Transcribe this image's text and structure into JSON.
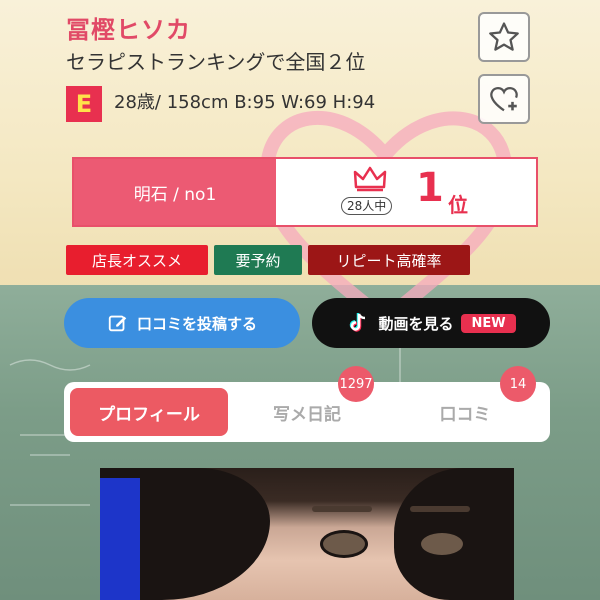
{
  "profile": {
    "name": "冨樫ヒソカ",
    "catchphrase": "セラピストランキングで全国２位",
    "rank_letter": "E",
    "stats": "28歳/ 158cm B:95 W:69 H:94"
  },
  "ranking": {
    "area_label": "明石 / no1",
    "of_count": "28人中",
    "position": "1",
    "position_unit": "位"
  },
  "tags": [
    "店長オススメ",
    "要予約",
    "リピート高確率"
  ],
  "actions": {
    "post_review": "口コミを投稿する",
    "watch_video": "動画を見る",
    "new_badge": "NEW"
  },
  "tabs": [
    {
      "label": "プロフィール",
      "active": true
    },
    {
      "label": "写メ日記",
      "badge": "1297"
    },
    {
      "label": "口コミ",
      "badge": "14"
    }
  ],
  "colors": {
    "accent": "#e8304f",
    "name": "#e14a67",
    "tag_recommend": "#e81e2e",
    "tag_reserve": "#1f7a53",
    "tag_repeat": "#9c1616",
    "post_button": "#3b8fe0",
    "video_button": "#111111"
  },
  "icons": {
    "favorite": "star-icon",
    "like": "heart-plus-icon",
    "ranking": "crown-icon",
    "post": "edit-icon",
    "video": "tiktok-icon"
  }
}
